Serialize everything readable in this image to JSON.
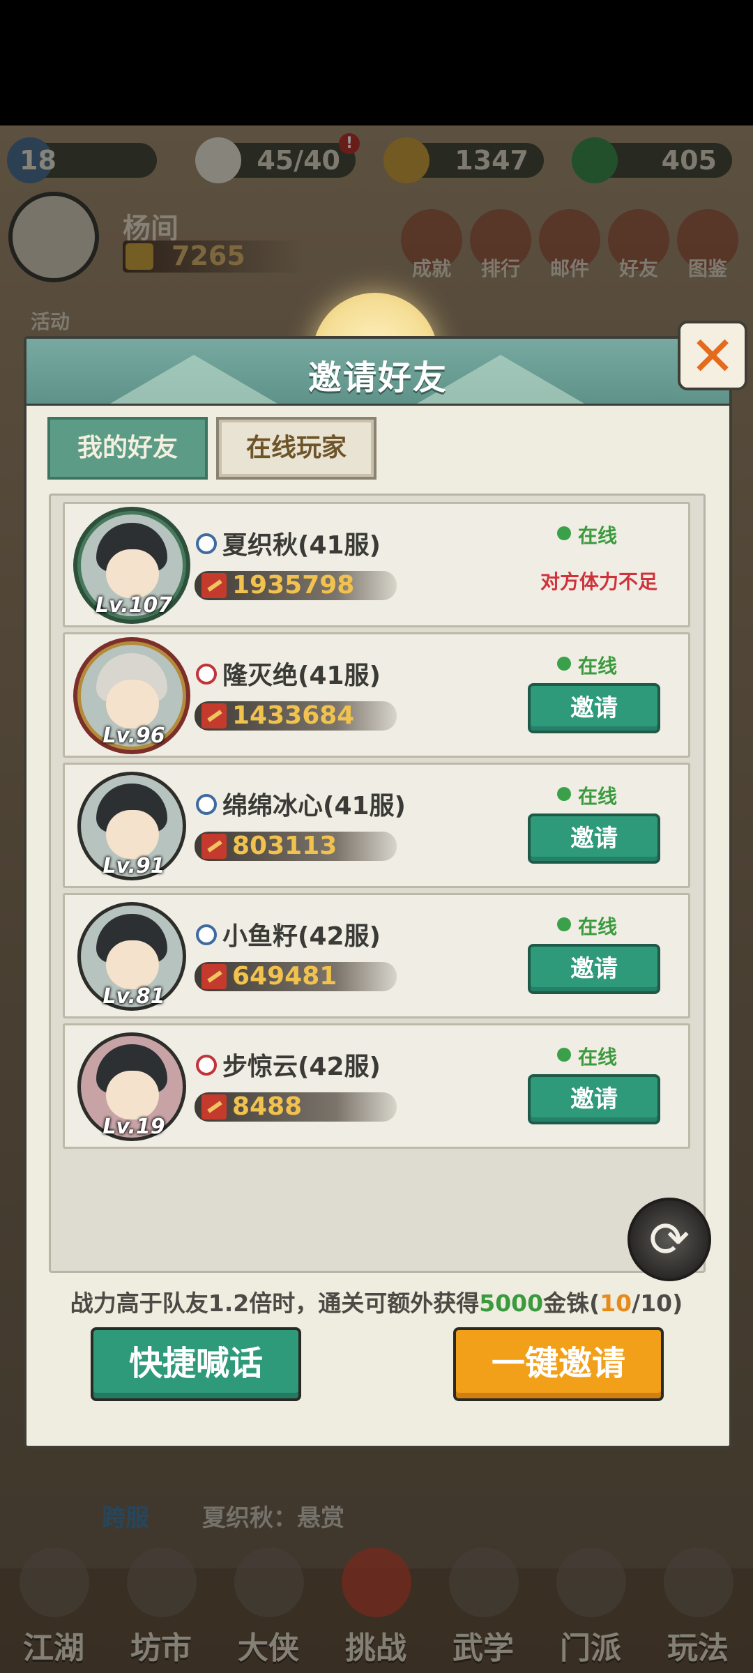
{
  "hud": {
    "level": "18",
    "stamina": "45/40",
    "coins": "1347",
    "jade": "405",
    "stamina_badge": "!"
  },
  "player": {
    "name": "杨间",
    "power": "7265"
  },
  "top_buttons": [
    {
      "label": "成就"
    },
    {
      "label": "排行"
    },
    {
      "label": "邮件"
    },
    {
      "label": "好友"
    },
    {
      "label": "图鉴"
    }
  ],
  "activity_label": "活动",
  "dialog": {
    "title": "邀请好友",
    "close_symbol": "✕",
    "tabs": [
      {
        "label": "我的好友",
        "active": true
      },
      {
        "label": "在线玩家",
        "active": false
      }
    ],
    "players": [
      {
        "name": "夏织秋(41服)",
        "power": "1935798",
        "level": "Lv.107",
        "gender": "male",
        "status": "在线",
        "action": "对方体力不足"
      },
      {
        "name": "隆灭绝(41服)",
        "power": "1433684",
        "level": "Lv.96",
        "gender": "female",
        "status": "在线",
        "action": "邀请"
      },
      {
        "name": "绵绵冰心(41服)",
        "power": "803113",
        "level": "Lv.91",
        "gender": "male",
        "status": "在线",
        "action": "邀请"
      },
      {
        "name": "小鱼籽(42服)",
        "power": "649481",
        "level": "Lv.81",
        "gender": "male",
        "status": "在线",
        "action": "邀请"
      },
      {
        "name": "步惊云(42服)",
        "power": "8488",
        "level": "Lv.19",
        "gender": "female",
        "status": "在线",
        "action": "邀请"
      }
    ],
    "refresh_symbol": "⟳",
    "bonus": {
      "prefix": "战力高于队友1.2倍时，通关可额外获得",
      "amount": "5000",
      "currency": "金铢(",
      "current": "10",
      "total_suffix": "/10)"
    },
    "quick_shout_label": "快捷喊话",
    "invite_all_label": "一键邀请"
  },
  "chat": {
    "channel": "跨服",
    "message": "夏织秋：悬赏"
  },
  "bottom_nav": [
    {
      "label": "江湖"
    },
    {
      "label": "坊市"
    },
    {
      "label": "大侠"
    },
    {
      "label": "挑战"
    },
    {
      "label": "武学"
    },
    {
      "label": "门派"
    },
    {
      "label": "玩法"
    }
  ],
  "colors": {
    "accent_green": "#2f9a79",
    "accent_orange": "#f2a01a",
    "online_green": "#3c9a3e",
    "warning_red": "#d0323c",
    "power_gold": "#f2c24e"
  }
}
